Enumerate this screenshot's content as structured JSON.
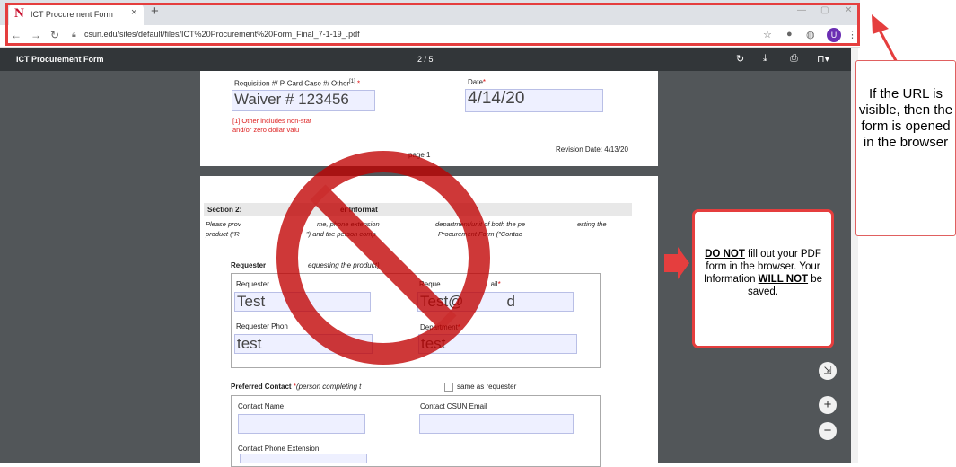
{
  "browser": {
    "tab_title": "ICT Procurement Form",
    "tab_close": "×",
    "new_tab": "+",
    "favicon_letter": "N",
    "url": "csun.edu/sites/default/files/ICT%20Procurement%20Form_Final_7-1-19_.pdf",
    "avatar_letter": "U"
  },
  "pdf_viewer": {
    "title": "ICT Procurement Form",
    "page_indicator": "2 / 5"
  },
  "page1": {
    "req_label": "Requisition #/ P-Card Case #/ Other",
    "req_sup": "[1]",
    "req_star": "*",
    "req_value": "Waiver # 123456",
    "date_label": "Date",
    "date_star": "*",
    "date_value": "4/14/20",
    "footnote_1": "[1] Other includes non-stat",
    "footnote_2": "and/or zero dollar valu",
    "page_label": "page 1",
    "revision": "Revision Date: 4/13/20"
  },
  "page2": {
    "section_title": "Section 2:",
    "section_title_rest": "er Informat",
    "instr_1a": "Please prov",
    "instr_1b": "me, phone extension",
    "instr_1c": "department/unit of both the pe",
    "instr_1d": "esting the",
    "instr_2a": "product (\"R",
    "instr_2b": "\") and the person comp",
    "instr_2c": "Procurement Form (\"Contac",
    "requester_head": "Requester",
    "requester_head_it": "equesting the product)",
    "requester_name_label": "Requester",
    "requester_name_value": "Test",
    "requester_email_label": "Reque",
    "requester_email_label_2": "ail",
    "requester_email_value": "Test@",
    "requester_email_value_2": "d",
    "requester_phone_label": "Requester Phon",
    "requester_phone_value": "test",
    "department_label": "Department",
    "department_value": "test",
    "preferred_contact": "Preferred Contact ",
    "preferred_contact_it": "(person completing t",
    "same_as_requester": "same as requester",
    "contact_name_label": "Contact Name",
    "contact_email_label": "Contact CSUN Email",
    "contact_phone_label": "Contact Phone Extension"
  },
  "callouts": {
    "url_note": "If the URL is visible, then the form is opened in the browser",
    "warn_1": "DO NOT",
    "warn_2": " fill out your PDF form in the browser. Your Information ",
    "warn_3": "WILL NOT",
    "warn_4": " be saved."
  },
  "colors": {
    "accent_red": "#e53e3e",
    "pdf_toolbar": "#323639",
    "viewer_bg": "#525659"
  },
  "icons": [
    "back-icon",
    "forward-icon",
    "reload-icon",
    "lock-icon",
    "star-icon",
    "extension-icon",
    "rotate-icon",
    "download-icon",
    "print-icon",
    "bookmark-icon",
    "fit-icon",
    "zoom-in-icon",
    "zoom-out-icon",
    "prohibition-icon"
  ]
}
